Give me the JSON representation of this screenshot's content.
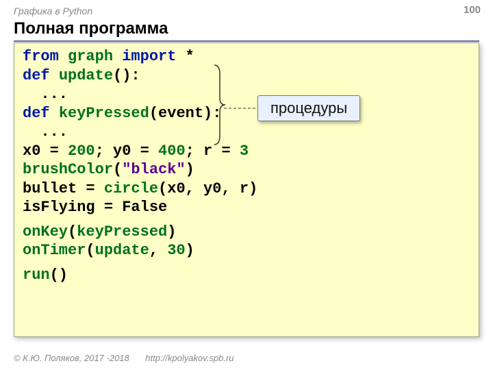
{
  "header": {
    "topic": "Графика в Python",
    "page_number": "100",
    "title": "Полная программа"
  },
  "callout": "процедуры",
  "code": {
    "l1_from": "from",
    "l1_mod": "graph",
    "l1_import": "import",
    "l1_star": "*",
    "l2_def": "def",
    "l2_name": "update",
    "l2_tail": "():",
    "l3": "  ...",
    "l4_def": "def",
    "l4_name": "keyPressed",
    "l4_tail": "(event):",
    "l5": "  ...",
    "l6_a": "x0 = ",
    "l6_200": "200",
    "l6_b": "; y0 = ",
    "l6_400": "400",
    "l6_c": "; r = ",
    "l6_3": "3",
    "l7_fn": "brushColor",
    "l7_op": "(",
    "l7_str": "\"black\"",
    "l7_cl": ")",
    "l8_a": "bullet = ",
    "l8_fn": "circle",
    "l8_tail": "(x0, y0, r)",
    "l9": "isFlying = False",
    "l10_fn": "onKey",
    "l10_op": "(",
    "l10_arg": "keyPressed",
    "l10_cl": ")",
    "l11_fn": "onTimer",
    "l11_op": "(",
    "l11_arg": "update",
    "l11_sep": ", ",
    "l11_num": "30",
    "l11_cl": ")",
    "l12_fn": "run",
    "l12_tail": "()"
  },
  "footer": {
    "copyright": "© К.Ю. Поляков, 2017 -2018",
    "url": "http://kpolyakov.spb.ru"
  }
}
